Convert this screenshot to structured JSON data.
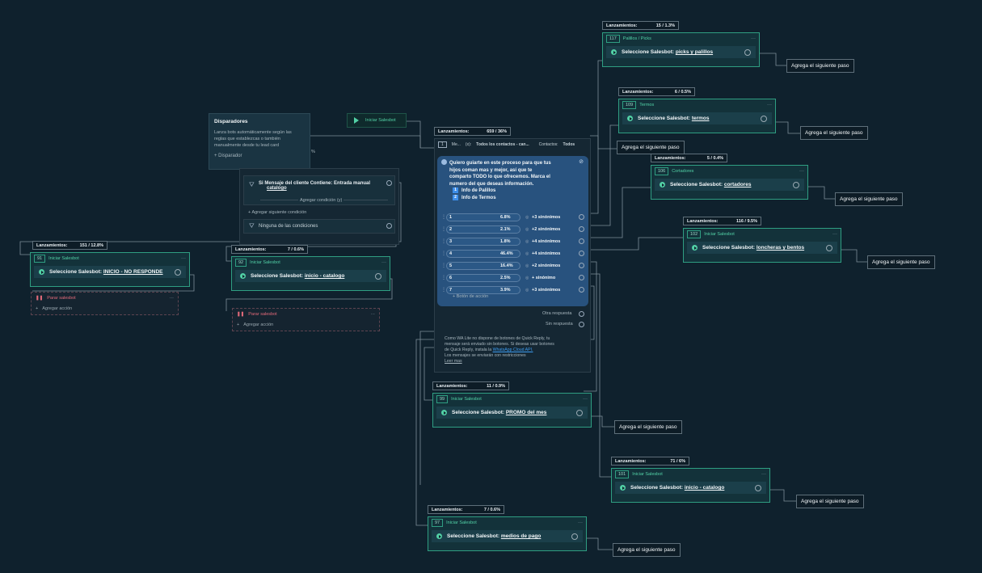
{
  "tooltip": {
    "title": "Disparadores",
    "desc1": "Lanza bots automáticamente según las",
    "desc2": "reglas que establezcas o también",
    "desc3": "manualmente desde tu lead card",
    "add": "+ Disparador"
  },
  "trigger": {
    "label": "Iniciar Salesbot"
  },
  "conditions": {
    "c1": "Si Mensaje del cliente Contiene: Entrada manual",
    "c1b": "catalogo",
    "add_cond": "Agregar condición (y)",
    "add_next": "Agregar siguiente condición",
    "none": "Ninguna de las condiciones",
    "pct": "%"
  },
  "central": {
    "launch": "Lanzamientos:",
    "launch_val": "659 / 36%",
    "idx": "1",
    "me": "Me...",
    "x": "(x):",
    "all": "Todos los contactos - can...",
    "contacts": "Contactos:",
    "contacts_val": "Todos",
    "msg1": "Quiero guiarte en este proceso para que tus",
    "msg2": "hijos coman mas y mejor, así que te",
    "msg3": "comparto TODO lo que ofrecemos. Marca el",
    "msg4": "numero del que deseas información.",
    "opt1_n": "1",
    "opt1": "Info de Palillos",
    "opt2_n": "2",
    "opt2": "Info de Termos",
    "rows": [
      {
        "n": "1",
        "p": "6.8%",
        "s": "+3 sinónimos"
      },
      {
        "n": "2",
        "p": "2.1%",
        "s": "+2 sinónimos"
      },
      {
        "n": "3",
        "p": "1.8%",
        "s": "+4 sinónimos"
      },
      {
        "n": "4",
        "p": "46.4%",
        "s": "+4 sinónimos"
      },
      {
        "n": "5",
        "p": "16.4%",
        "s": "+2 sinónimos"
      },
      {
        "n": "6",
        "p": "2.5%",
        "s": "+ sinónimo"
      },
      {
        "n": "7",
        "p": "3.9%",
        "s": "+3 sinónimos"
      }
    ],
    "action": "Botón de acción",
    "other": "Otra respuesta",
    "noans": "Sin respuesta",
    "info1": "Como WA Lite no dispone de botones de Quick Reply, tu",
    "info2": "mensaje será enviado sin botones. Si deseas usar botones",
    "info3a": "de Quick Reply, instala la ",
    "info3b": "WhatsApp Cloud API.",
    "info4": "Los mensajes se enviarán con restricciones",
    "info5": "Leer mas"
  },
  "nodes": [
    {
      "launch": "Lanzamientos:",
      "val": "15 / 1.3%",
      "idx": "117",
      "sub": "Palillos / Picks",
      "lbl": "Seleccione Salesbot:",
      "name": "picks y palillos",
      "next": "Agrega el siguiente paso"
    },
    {
      "launch": "Lanzamientos:",
      "val": "6 / 0.5%",
      "idx": "109",
      "sub": "Termos",
      "lbl": "Seleccione Salesbot:",
      "name": "termos",
      "next": "Agrega el siguiente paso"
    },
    {
      "launch": "Lanzamientos:",
      "val": "5 / 0.4%",
      "idx": "106",
      "sub": "Cortadores",
      "lbl": "Seleccione Salesbot:",
      "name": "cortadores",
      "next": "Agrega el siguiente paso"
    },
    {
      "launch": "Lanzamientos:",
      "val": "116 / 9.5%",
      "idx": "102",
      "sub": "Iniciar Salesbot",
      "lbl": "Seleccione Salesbot:",
      "name": "loncheras y bentos",
      "next": "Agrega el siguiente paso"
    },
    {
      "launch": "Lanzamientos:",
      "val": "151 / 12.8%",
      "idx": "91",
      "sub": "Iniciar Salesbot",
      "lbl": "Seleccione Salesbot:",
      "name": "INICIO - NO RESPONDE"
    },
    {
      "launch": "Lanzamientos:",
      "val": "7 / 0.6%",
      "idx": "92",
      "sub": "Iniciar Salesbot",
      "lbl": "Seleccione Salesbot:",
      "name": "inicio - catalogo"
    },
    {
      "launch": "Lanzamientos:",
      "val": "11 / 0.9%",
      "idx": "99",
      "sub": "Iniciar Salesbot",
      "lbl": "Seleccione Salesbot:",
      "name": "PROMO del mes",
      "next": "Agrega el siguiente paso"
    },
    {
      "launch": "Lanzamientos:",
      "val": "71 / 6%",
      "idx": "101",
      "sub": "Iniciar Salesbot",
      "lbl": "Seleccione Salesbot:",
      "name": "inicio - catalogo",
      "next": "Agrega el siguiente paso"
    },
    {
      "launch": "Lanzamientos:",
      "val": "7 / 0.6%",
      "idx": "97",
      "sub": "Iniciar Salesbot",
      "lbl": "Seleccione Salesbot:",
      "name": "medios de pago",
      "next": "Agrega el siguiente paso"
    }
  ],
  "next_central": "Agrega el siguiente paso",
  "stop": {
    "label": "Parar salesbot",
    "add": "Agregar acción"
  }
}
